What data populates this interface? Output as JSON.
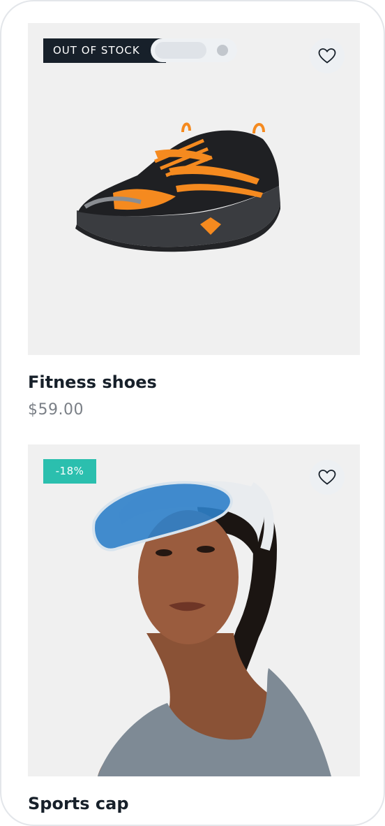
{
  "products": [
    {
      "name": "Fitness shoes",
      "price": "$59.00",
      "badge": "OUT OF STOCK",
      "wishlist_icon": "heart-icon"
    },
    {
      "name": "Sports cap",
      "badge": "-18%",
      "wishlist_icon": "heart-icon"
    }
  ],
  "colors": {
    "dark": "#17202a",
    "sale_badge": "#2bbfae",
    "price": "#7a7f86",
    "image_bg": "#f0f0f0"
  }
}
